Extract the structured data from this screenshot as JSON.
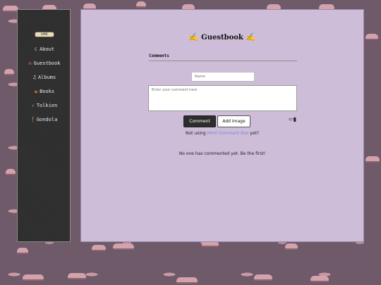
{
  "sidebar": {
    "home_badge": "HOME",
    "items": [
      {
        "label": "About",
        "icon": "moon-icon"
      },
      {
        "label": "Guestbook",
        "icon": "envelope-icon"
      },
      {
        "label": "Albums",
        "icon": "music-note-icon"
      },
      {
        "label": "Books",
        "icon": "book-icon"
      },
      {
        "label": "Tolkien",
        "icon": "sparkle-icon"
      },
      {
        "label": "Gondola",
        "icon": "gondola-icon"
      }
    ]
  },
  "main": {
    "title": "Guestbook",
    "comments_heading": "Comments",
    "form": {
      "name_placeholder": "Name",
      "comment_placeholder": "Enter your comment here",
      "comment_button": "Comment",
      "add_image_button": "Add Image"
    },
    "notice": {
      "prefix": "Not using ",
      "link": "Html Comment Box",
      "suffix": " yet?"
    },
    "empty_message": "No one has commented yet. Be the first!"
  },
  "colors": {
    "background": "#6e5a68",
    "cloud": "#d3a2ad",
    "sidebar": "#2e2e2e",
    "panel": "#cdbdd8",
    "link": "#7a86d8"
  }
}
